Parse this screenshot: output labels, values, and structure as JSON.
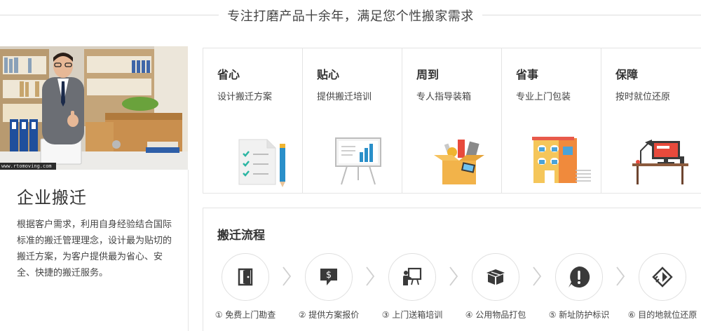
{
  "header": {
    "title": "专注打磨产品十余年，满足您个性搬家需求"
  },
  "hero": {
    "watermark": "www.rtomoving.com"
  },
  "intro": {
    "title": "企业搬迁",
    "description": "根据客户需求，利用自身经验结合国际标准的搬迁管理理念，设计最为贴切的搬迁方案，为客户提供最为省心、安全、快捷的搬迁服务。"
  },
  "features": [
    {
      "title": "省心",
      "desc": "设计搬迁方案",
      "icon": "checklist-icon"
    },
    {
      "title": "贴心",
      "desc": "提供搬迁培训",
      "icon": "presentation-board-icon"
    },
    {
      "title": "周到",
      "desc": "专人指导装箱",
      "icon": "packing-box-icon"
    },
    {
      "title": "省事",
      "desc": "专业上门包装",
      "icon": "building-icon"
    },
    {
      "title": "保障",
      "desc": "按时就位还原",
      "icon": "office-desk-icon"
    }
  ],
  "process": {
    "title": "搬迁流程",
    "steps": [
      {
        "label": "① 免费上门勘查",
        "icon": "door-icon"
      },
      {
        "label": "② 提供方案报价",
        "icon": "quote-icon"
      },
      {
        "label": "③ 上门送箱培训",
        "icon": "training-icon"
      },
      {
        "label": "④ 公用物品打包",
        "icon": "box-icon"
      },
      {
        "label": "⑤ 新址防护标识",
        "icon": "alert-icon"
      },
      {
        "label": "⑥ 目的地就位还原",
        "icon": "restore-icon"
      }
    ]
  },
  "colors": {
    "accent_red": "#e84a3c",
    "icon_dark": "#3a3a3a",
    "teal": "#27b3a8",
    "border": "#e4e4e4"
  }
}
